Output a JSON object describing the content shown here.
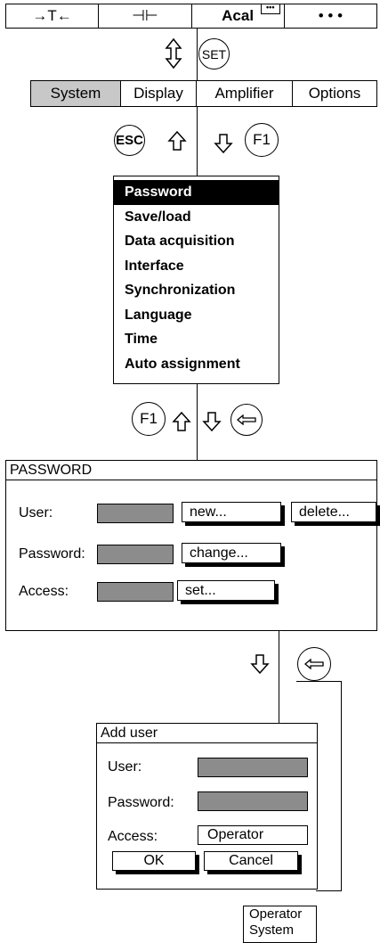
{
  "toolbar": {
    "items": [
      "→T←",
      "⊣⊢",
      "Acal",
      "• • •"
    ],
    "acal_badge": "•••"
  },
  "controls": {
    "set_label": "SET",
    "esc_label": "ESC",
    "f1_label": "F1",
    "enter_icon": "enter-arrow-icon",
    "updown_icon": "up-down-arrow-icon",
    "up_icon": "up-arrow-icon",
    "down_icon": "down-arrow-icon"
  },
  "menubar": {
    "items": [
      "System",
      "Display",
      "Amplifier",
      "Options"
    ],
    "selected": "System"
  },
  "dropdown": {
    "items": [
      "Password",
      "Save/load",
      "Data acquisition",
      "Interface",
      "Synchronization",
      "Language",
      "Time",
      "Auto assignment"
    ],
    "highlighted": "Password"
  },
  "password_panel": {
    "title": "PASSWORD",
    "user_label": "User:",
    "password_label": "Password:",
    "access_label": "Access:",
    "new_button": "new...",
    "delete_button": "delete...",
    "change_button": "change...",
    "set_button": "set..."
  },
  "add_user_panel": {
    "title": "Add user",
    "user_label": "User:",
    "password_label": "Password:",
    "access_label": "Access:",
    "access_value": "Operator",
    "ok_button": "OK",
    "cancel_button": "Cancel"
  },
  "access_options": [
    "Operator",
    "System"
  ],
  "colors": {
    "field_fill": "#8c8c8c",
    "selected_menu": "#c8c8c8",
    "highlight": "#000000"
  }
}
